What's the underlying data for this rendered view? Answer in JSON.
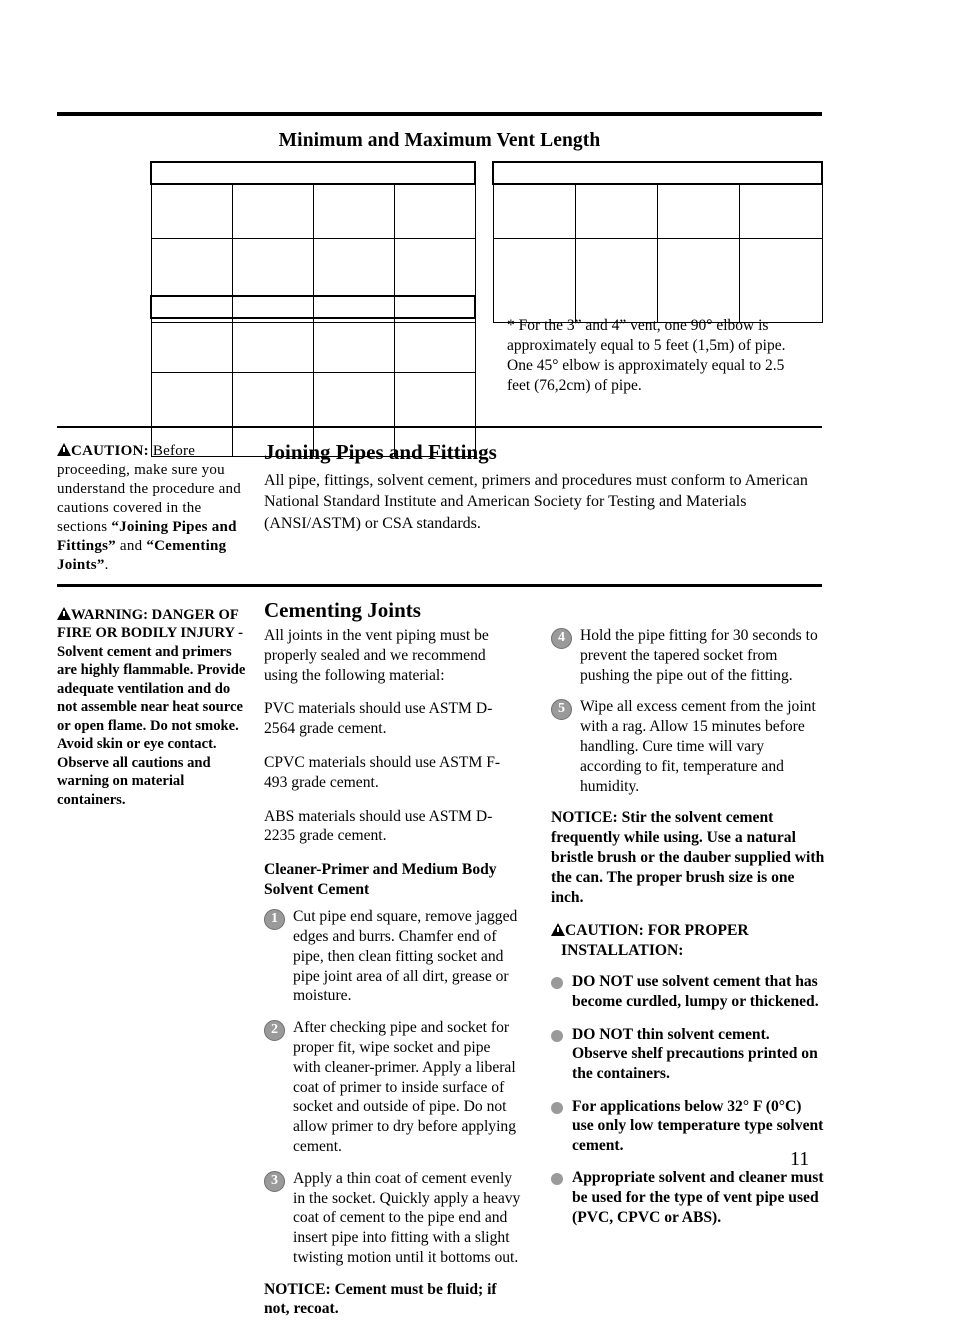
{
  "page": {
    "number": "11"
  },
  "vent_section": {
    "title": "Minimum and Maximum Vent Length",
    "tables": [
      {
        "id": "table-a",
        "title": "",
        "headers": [
          "",
          "",
          "",
          ""
        ],
        "rows": [
          [
            "",
            "",
            "",
            ""
          ]
        ]
      },
      {
        "id": "table-b",
        "title": "",
        "headers": [
          "",
          "",
          "",
          ""
        ],
        "rows": [
          [
            "",
            "",
            "",
            ""
          ]
        ]
      },
      {
        "id": "table-c",
        "title": "",
        "headers": [
          "",
          "",
          "",
          ""
        ],
        "rows": [
          [
            "",
            "",
            "",
            ""
          ]
        ]
      }
    ],
    "footnote": "* For the 3” and 4” vent, one 90° elbow is approximately equal to 5 feet (1,5m) of pipe. One 45° elbow is approximately equal to 2.5 feet (76,2cm) of pipe."
  },
  "joining_section": {
    "caution": {
      "label": "CAUTION:",
      "text_1": " Before proceeding, make sure you understand the procedure and cautions covered in the sections ",
      "bold_1": "“Joining Pipes and Fittings”",
      "text_2": " and ",
      "bold_2": "“Cementing Joints”",
      "text_3": "."
    },
    "heading": "Joining Pipes and Fittings",
    "body": "All pipe, fittings, solvent cement, primers and procedures must conform to American National Standard Institute and American Society for Testing and Materials (ANSI/ASTM) or CSA standards."
  },
  "cementing_section": {
    "warning": {
      "label": "WARNING: DANGER OF FIRE OR BODILY INJURY",
      "text": " - Solvent cement and primers are highly flammable.  Provide adequate ventilation and do not assemble near heat source or open flame.  Do not smoke.  Avoid skin or eye contact. Observe all cautions and warning on material containers."
    },
    "heading": "Cementing Joints",
    "intro": "All joints in the vent piping must be properly sealed and we recommend using the following material:",
    "materials": [
      "PVC materials should use ASTM D-2564 grade cement.",
      "CPVC materials should use ASTM F-493 grade cement.",
      "ABS materials should use ASTM D-2235 grade cement."
    ],
    "steps_subhead": "Cleaner-Primer and Medium Body Solvent Cement",
    "steps": [
      {
        "number": "1",
        "text": "Cut pipe end square, remove jagged edges and burrs. Chamfer end of pipe, then clean fitting socket and pipe joint area of all dirt, grease or moisture."
      },
      {
        "number": "2",
        "text": "After checking pipe and socket for proper fit, wipe socket and pipe with cleaner-primer. Apply a liberal coat of primer to inside surface of socket and outside of pipe. Do not allow primer to dry before applying cement."
      },
      {
        "number": "3",
        "text": "Apply a thin coat of cement evenly in the socket. Quickly apply a heavy coat of cement to the pipe end and insert pipe into fitting with a slight twisting motion until it bottoms out."
      },
      {
        "number": "4",
        "text": "Hold the pipe fitting for 30 seconds to prevent the tapered socket from pushing the pipe out of the fitting."
      },
      {
        "number": "5",
        "text": "Wipe all excess cement from the joint with a rag. Allow 15 minutes before handling. Cure time will vary according to fit, temperature and humidity."
      }
    ],
    "notice_left": "NOTICE: Cement must be fluid; if not, recoat.",
    "notice_right": "NOTICE: Stir the solvent cement frequently while using. Use a natural bristle brush or the dauber supplied with the can. The proper brush size is one inch.",
    "caution_installation": {
      "line_1": "CAUTION: FOR PROPER",
      "line_2": "INSTALLATION:",
      "bullets": [
        "DO NOT use solvent cement that has become curdled, lumpy or thickened.",
        "DO NOT thin solvent cement. Observe shelf precautions printed on the containers.",
        "For applications below 32° F (0°C) use only low temperature type solvent cement.",
        "Appropriate solvent and cleaner must be used for the type of vent pipe used (PVC, CPVC or ABS)."
      ]
    }
  }
}
